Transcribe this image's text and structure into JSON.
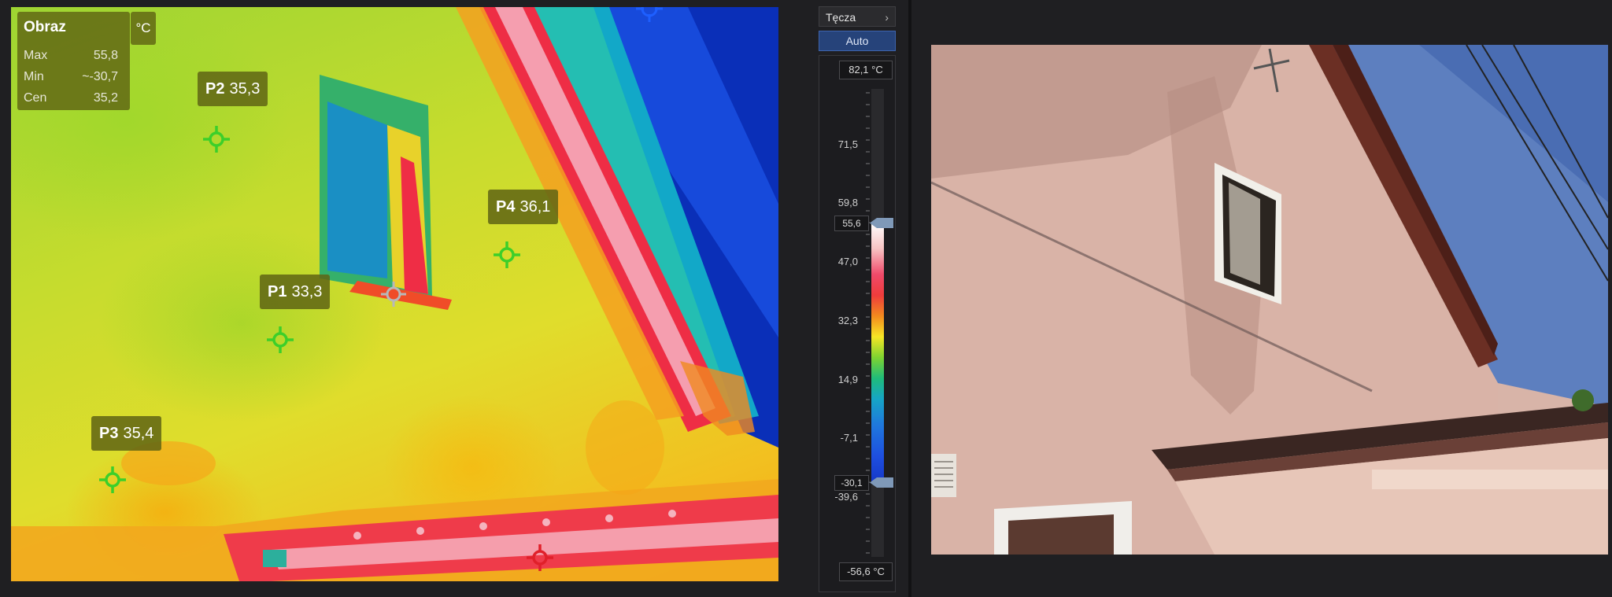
{
  "thermal": {
    "info": {
      "title": "Obraz",
      "unit": "°C",
      "rows": [
        {
          "label": "Max",
          "value": "55,8"
        },
        {
          "label": "Min",
          "value": "~-30,7"
        },
        {
          "label": "Cen",
          "value": "35,2"
        }
      ]
    },
    "points": [
      {
        "name": "P2",
        "value": "35,3"
      },
      {
        "name": "P4",
        "value": "36,1"
      },
      {
        "name": "P1",
        "value": "33,3"
      },
      {
        "name": "P3",
        "value": "35,4"
      }
    ]
  },
  "palette": {
    "selected": "Tęcza",
    "auto_label": "Auto",
    "max_box": "82,1 °C",
    "min_box": "-56,6 °C",
    "ticks": [
      "71,5",
      "59,8",
      "47,0",
      "32,3",
      "14,9",
      "-7,1",
      "-39,6"
    ],
    "upper_handle": "55,6",
    "lower_handle": "-30,1"
  },
  "colors": {
    "accent_blue": "#26437a",
    "label_bg": "#5f6414",
    "marker_green": "#3ccf2a",
    "marker_red": "#e0202a",
    "marker_blue": "#1e5fff"
  }
}
